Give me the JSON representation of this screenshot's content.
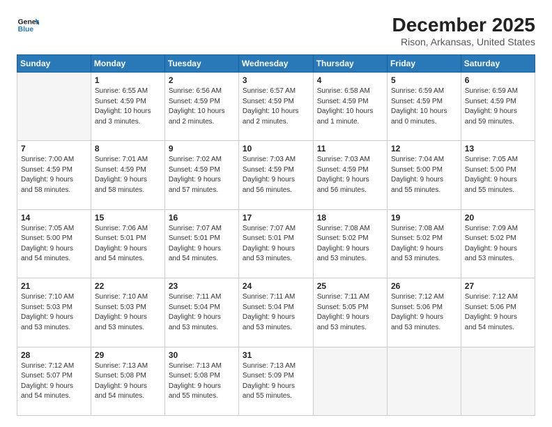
{
  "header": {
    "logo_line1": "General",
    "logo_line2": "Blue",
    "month": "December 2025",
    "location": "Rison, Arkansas, United States"
  },
  "weekdays": [
    "Sunday",
    "Monday",
    "Tuesday",
    "Wednesday",
    "Thursday",
    "Friday",
    "Saturday"
  ],
  "weeks": [
    [
      {
        "day": "",
        "info": ""
      },
      {
        "day": "1",
        "info": "Sunrise: 6:55 AM\nSunset: 4:59 PM\nDaylight: 10 hours\nand 3 minutes."
      },
      {
        "day": "2",
        "info": "Sunrise: 6:56 AM\nSunset: 4:59 PM\nDaylight: 10 hours\nand 2 minutes."
      },
      {
        "day": "3",
        "info": "Sunrise: 6:57 AM\nSunset: 4:59 PM\nDaylight: 10 hours\nand 2 minutes."
      },
      {
        "day": "4",
        "info": "Sunrise: 6:58 AM\nSunset: 4:59 PM\nDaylight: 10 hours\nand 1 minute."
      },
      {
        "day": "5",
        "info": "Sunrise: 6:59 AM\nSunset: 4:59 PM\nDaylight: 10 hours\nand 0 minutes."
      },
      {
        "day": "6",
        "info": "Sunrise: 6:59 AM\nSunset: 4:59 PM\nDaylight: 9 hours\nand 59 minutes."
      }
    ],
    [
      {
        "day": "7",
        "info": "Sunrise: 7:00 AM\nSunset: 4:59 PM\nDaylight: 9 hours\nand 58 minutes."
      },
      {
        "day": "8",
        "info": "Sunrise: 7:01 AM\nSunset: 4:59 PM\nDaylight: 9 hours\nand 58 minutes."
      },
      {
        "day": "9",
        "info": "Sunrise: 7:02 AM\nSunset: 4:59 PM\nDaylight: 9 hours\nand 57 minutes."
      },
      {
        "day": "10",
        "info": "Sunrise: 7:03 AM\nSunset: 4:59 PM\nDaylight: 9 hours\nand 56 minutes."
      },
      {
        "day": "11",
        "info": "Sunrise: 7:03 AM\nSunset: 4:59 PM\nDaylight: 9 hours\nand 56 minutes."
      },
      {
        "day": "12",
        "info": "Sunrise: 7:04 AM\nSunset: 5:00 PM\nDaylight: 9 hours\nand 55 minutes."
      },
      {
        "day": "13",
        "info": "Sunrise: 7:05 AM\nSunset: 5:00 PM\nDaylight: 9 hours\nand 55 minutes."
      }
    ],
    [
      {
        "day": "14",
        "info": "Sunrise: 7:05 AM\nSunset: 5:00 PM\nDaylight: 9 hours\nand 54 minutes."
      },
      {
        "day": "15",
        "info": "Sunrise: 7:06 AM\nSunset: 5:01 PM\nDaylight: 9 hours\nand 54 minutes."
      },
      {
        "day": "16",
        "info": "Sunrise: 7:07 AM\nSunset: 5:01 PM\nDaylight: 9 hours\nand 54 minutes."
      },
      {
        "day": "17",
        "info": "Sunrise: 7:07 AM\nSunset: 5:01 PM\nDaylight: 9 hours\nand 53 minutes."
      },
      {
        "day": "18",
        "info": "Sunrise: 7:08 AM\nSunset: 5:02 PM\nDaylight: 9 hours\nand 53 minutes."
      },
      {
        "day": "19",
        "info": "Sunrise: 7:08 AM\nSunset: 5:02 PM\nDaylight: 9 hours\nand 53 minutes."
      },
      {
        "day": "20",
        "info": "Sunrise: 7:09 AM\nSunset: 5:02 PM\nDaylight: 9 hours\nand 53 minutes."
      }
    ],
    [
      {
        "day": "21",
        "info": "Sunrise: 7:10 AM\nSunset: 5:03 PM\nDaylight: 9 hours\nand 53 minutes."
      },
      {
        "day": "22",
        "info": "Sunrise: 7:10 AM\nSunset: 5:03 PM\nDaylight: 9 hours\nand 53 minutes."
      },
      {
        "day": "23",
        "info": "Sunrise: 7:11 AM\nSunset: 5:04 PM\nDaylight: 9 hours\nand 53 minutes."
      },
      {
        "day": "24",
        "info": "Sunrise: 7:11 AM\nSunset: 5:04 PM\nDaylight: 9 hours\nand 53 minutes."
      },
      {
        "day": "25",
        "info": "Sunrise: 7:11 AM\nSunset: 5:05 PM\nDaylight: 9 hours\nand 53 minutes."
      },
      {
        "day": "26",
        "info": "Sunrise: 7:12 AM\nSunset: 5:06 PM\nDaylight: 9 hours\nand 53 minutes."
      },
      {
        "day": "27",
        "info": "Sunrise: 7:12 AM\nSunset: 5:06 PM\nDaylight: 9 hours\nand 54 minutes."
      }
    ],
    [
      {
        "day": "28",
        "info": "Sunrise: 7:12 AM\nSunset: 5:07 PM\nDaylight: 9 hours\nand 54 minutes."
      },
      {
        "day": "29",
        "info": "Sunrise: 7:13 AM\nSunset: 5:08 PM\nDaylight: 9 hours\nand 54 minutes."
      },
      {
        "day": "30",
        "info": "Sunrise: 7:13 AM\nSunset: 5:08 PM\nDaylight: 9 hours\nand 55 minutes."
      },
      {
        "day": "31",
        "info": "Sunrise: 7:13 AM\nSunset: 5:09 PM\nDaylight: 9 hours\nand 55 minutes."
      },
      {
        "day": "",
        "info": ""
      },
      {
        "day": "",
        "info": ""
      },
      {
        "day": "",
        "info": ""
      }
    ]
  ]
}
